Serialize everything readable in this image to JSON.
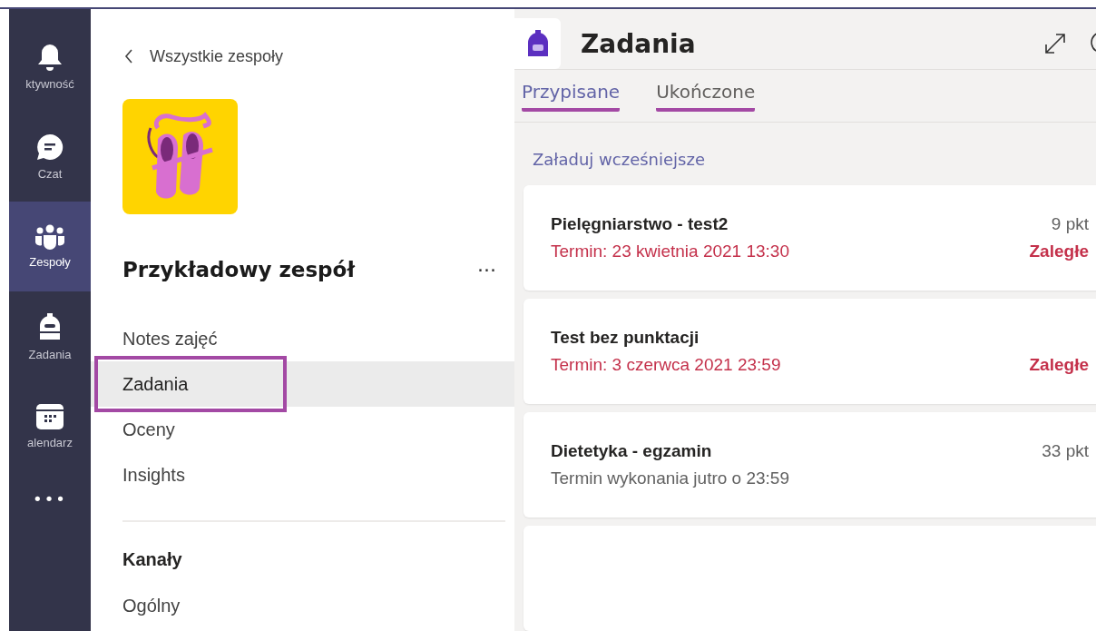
{
  "rail": [
    {
      "label": "ktywność",
      "kind": "bell",
      "selected": false
    },
    {
      "label": "Czat",
      "kind": "chat",
      "selected": false
    },
    {
      "label": "Zespoły",
      "kind": "people",
      "selected": true
    },
    {
      "label": "Zadania",
      "kind": "bag",
      "selected": false
    },
    {
      "label": "alendarz",
      "kind": "calendar",
      "selected": false
    },
    {
      "label": "•••",
      "kind": "more",
      "selected": false
    }
  ],
  "team": {
    "back": "Wszystkie zespoły",
    "name": "Przykładowy zespół",
    "more": "···",
    "nav": [
      {
        "label": "Notes zajęć",
        "selected": false,
        "annotated": false
      },
      {
        "label": "Zadania",
        "selected": true,
        "annotated": true
      },
      {
        "label": "Oceny",
        "selected": false,
        "annotated": false
      },
      {
        "label": "Insights",
        "selected": false,
        "annotated": false
      }
    ],
    "channels_heading": "Kanały",
    "channels": [
      "Ogólny"
    ]
  },
  "main": {
    "title": "Zadania",
    "tabs": [
      {
        "label": "Przypisane",
        "selected": true,
        "annotated": true
      },
      {
        "label": "Ukończone",
        "selected": false,
        "annotated": true
      }
    ],
    "load_more": "Załaduj wcześniejsze",
    "assignments": [
      {
        "title": "Pielęgniarstwo - test2",
        "points": "9 pkt",
        "due": "Termin: 23 kwietnia 2021 13:30",
        "status": "Zaległe",
        "overdue": true
      },
      {
        "title": "Test bez punktacji",
        "due": "Termin: 3 czerwca 2021 23:59",
        "status": "Zaległe",
        "overdue": true
      },
      {
        "title": "Dietetyka - egzamin",
        "points": "33 pkt",
        "due": "Termin wykonania jutro o 23:59",
        "overdue": false
      }
    ]
  }
}
